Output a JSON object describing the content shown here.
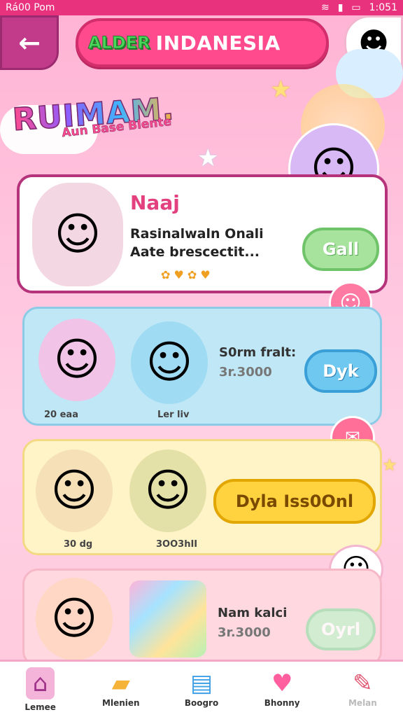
{
  "status": {
    "left": "Rá00 Pom",
    "time": "1:051"
  },
  "header": {
    "logo": "ALDER",
    "title": "INDANESIA"
  },
  "brand": {
    "name": "RUIMAM.",
    "tagline": "Aun Base Blente"
  },
  "cards": [
    {
      "name": "Naaj",
      "line1": "Rasinalwaln Onali",
      "line2": "Aate brescectit...",
      "button": "Gall"
    },
    {
      "desc": "S0rm fralt:",
      "price": "3r.3000",
      "tag1": "20 eaa",
      "tag2": "Ler liv",
      "button": "Dyk"
    },
    {
      "button": "Dyla Iss0Onl",
      "tag1": "30 dg",
      "tag2": "3OO3hII"
    },
    {
      "desc": "Nam kalci",
      "price": "3r.3000",
      "button": "Oyrl"
    }
  ],
  "nav": [
    {
      "label": "Lemee",
      "icon": "home-icon"
    },
    {
      "label": "Mlenien",
      "icon": "folder-icon"
    },
    {
      "label": "Boogro",
      "icon": "book-icon"
    },
    {
      "label": "Bhonny",
      "icon": "heart-icon"
    },
    {
      "label": "Melan",
      "icon": "pencil-icon"
    }
  ],
  "colors": {
    "accent": "#ff4b8e",
    "status": "#e8327e",
    "navActive": "#f4b3d8"
  }
}
